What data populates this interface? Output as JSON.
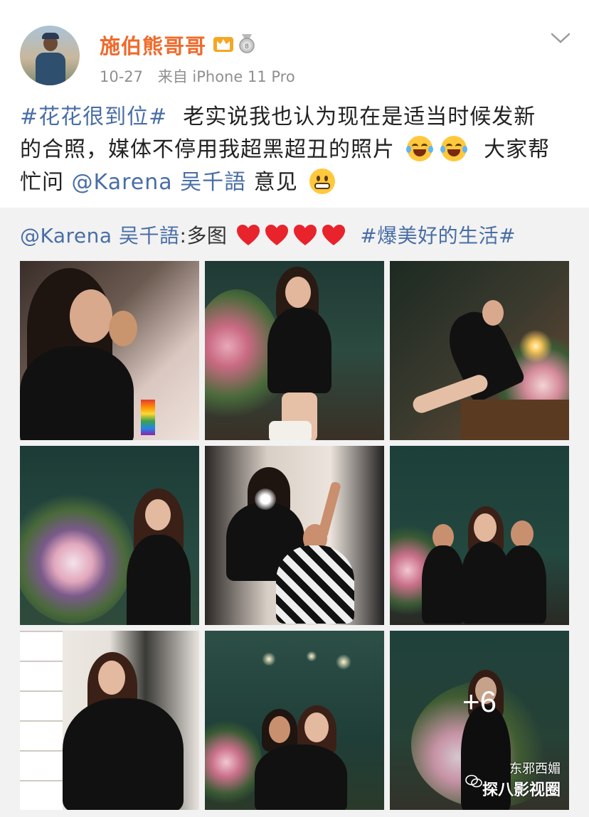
{
  "post": {
    "username": "施伯熊哥哥",
    "time": "10-27",
    "source": "来自 iPhone 11 Pro",
    "icons": [
      "crown-icon",
      "medal-icon",
      "chevron-down-icon"
    ],
    "text": {
      "hashtag": "#花花很到位#",
      "line1_rest": "老实说我也认为现在是适当时候发新",
      "line2": "的合照，媒体不停用我超黑超丑的照片",
      "line2_end": "大家帮",
      "line3_start": "忙问",
      "mention": "@Karena 吴千語",
      "line3_end": "意见"
    }
  },
  "repost": {
    "mention": "@Karena 吴千語",
    "after_mention": ":多图",
    "hashtag": "#爆美好的生活#",
    "heart_count": 4
  },
  "photos": [
    {
      "id": 1,
      "caption": ""
    },
    {
      "id": 2,
      "caption": ""
    },
    {
      "id": 3,
      "caption": ""
    },
    {
      "id": 4,
      "caption": ""
    },
    {
      "id": 5,
      "caption": ""
    },
    {
      "id": 6,
      "caption": ""
    },
    {
      "id": 7,
      "caption": ""
    },
    {
      "id": 8,
      "caption": ""
    },
    {
      "id": 9,
      "caption": ""
    }
  ],
  "more_photos": "+6",
  "watermark": {
    "top": "东邪西媚",
    "bottom": "探八影视圈"
  },
  "colors": {
    "username": "#f06a2b",
    "link": "#496ea6",
    "meta": "#8f8f8f",
    "repost_bg": "#f2f2f2"
  }
}
